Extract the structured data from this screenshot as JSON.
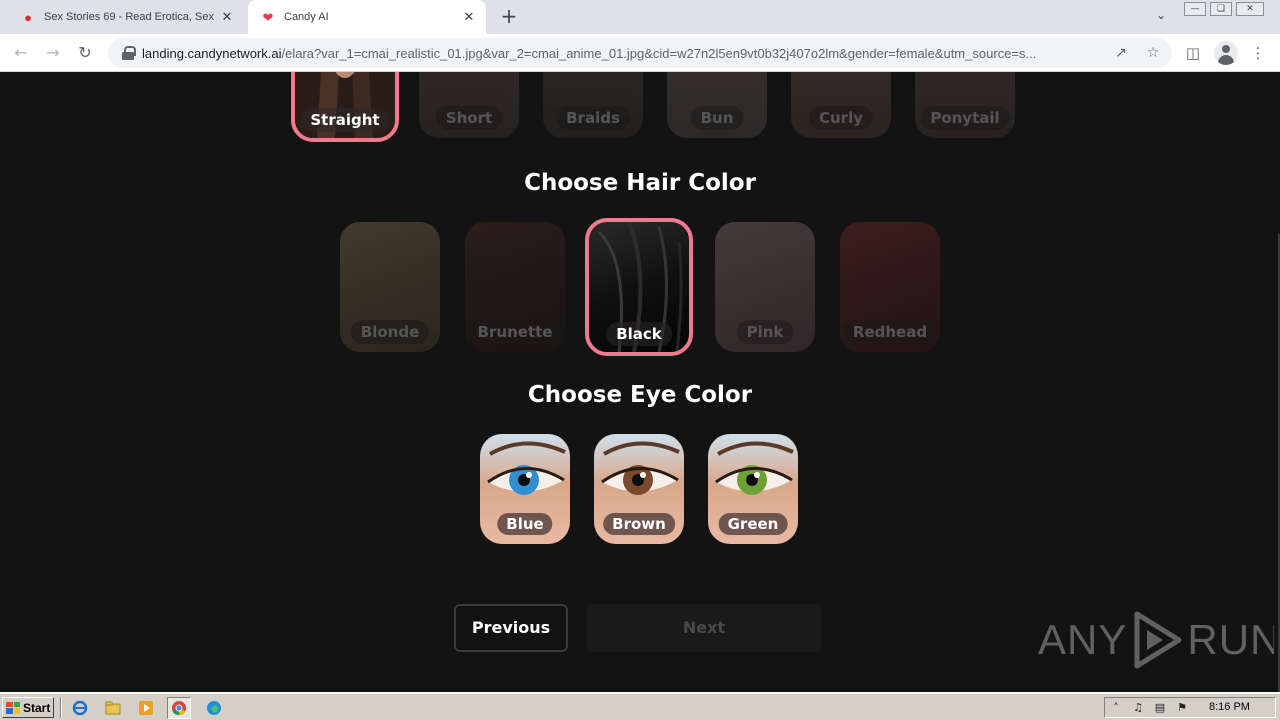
{
  "browser": {
    "tabs": [
      {
        "title": "Sex Stories 69 - Read Erotica, Sex St",
        "favicon": "lips-icon",
        "active": false
      },
      {
        "title": "Candy AI",
        "favicon": "heart-icon",
        "active": true
      }
    ],
    "url_host": "landing.candynetwork.ai",
    "url_path": "/elara?var_1=cmai_realistic_01.jpg&var_2=cmai_anime_01.jpg&cid=w27n2l5en9vt0b32j407o2lm&gender=female&utm_source=s..."
  },
  "hair_style": {
    "options": [
      {
        "label": "Straight",
        "selected": true
      },
      {
        "label": "Short",
        "selected": false
      },
      {
        "label": "Braids",
        "selected": false
      },
      {
        "label": "Bun",
        "selected": false
      },
      {
        "label": "Curly",
        "selected": false
      },
      {
        "label": "Ponytail",
        "selected": false
      }
    ]
  },
  "hair_color": {
    "title": "Choose Hair Color",
    "options": [
      {
        "label": "Blonde",
        "selected": false,
        "color": "#8a7a55"
      },
      {
        "label": "Brunette",
        "selected": false,
        "color": "#4a2a22"
      },
      {
        "label": "Black",
        "selected": true,
        "color": "#0d0d0d"
      },
      {
        "label": "Pink",
        "selected": false,
        "color": "#a57a80"
      },
      {
        "label": "Redhead",
        "selected": false,
        "color": "#7a2626"
      }
    ]
  },
  "eye_color": {
    "title": "Choose Eye Color",
    "options": [
      {
        "label": "Blue",
        "iris": "#2f8fd0"
      },
      {
        "label": "Brown",
        "iris": "#7a4a2a"
      },
      {
        "label": "Green",
        "iris": "#6fa236"
      }
    ]
  },
  "nav": {
    "previous": "Previous",
    "next": "Next"
  },
  "watermark": {
    "left": "ANY",
    "right": "RUN"
  },
  "taskbar": {
    "start": "Start",
    "clock": "8:16 PM"
  },
  "colors": {
    "accent": "#ef7a8e",
    "page_bg": "#131313"
  }
}
